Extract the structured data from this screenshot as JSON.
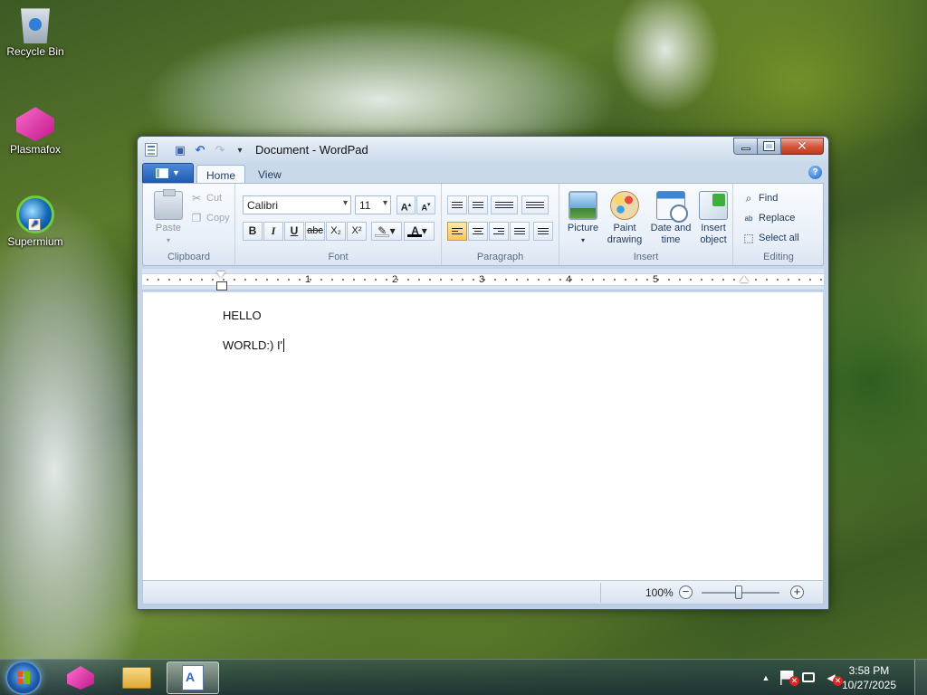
{
  "desktop": {
    "icons": [
      {
        "label": "Recycle Bin"
      },
      {
        "label": "Plasmafox"
      },
      {
        "label": "Supermium"
      }
    ]
  },
  "window": {
    "title": "Document - WordPad",
    "qat_more": "▾",
    "caption": {
      "close": "✕"
    }
  },
  "ribbon": {
    "tabs": {
      "home": "Home",
      "view": "View"
    },
    "help": "?",
    "groups": {
      "clipboard": {
        "label": "Clipboard",
        "paste": "Paste",
        "cut": "Cut",
        "copy": "Copy"
      },
      "font": {
        "label": "Font",
        "font_name": "Calibri",
        "font_size": "11",
        "grow": "A",
        "shrink": "A",
        "bold": "B",
        "italic": "I",
        "underline": "U",
        "strike": "abc",
        "subscript": "X₂",
        "superscript": "X²"
      },
      "paragraph": {
        "label": "Paragraph"
      },
      "insert": {
        "label": "Insert",
        "picture": "Picture",
        "paint": "Paint drawing",
        "datetime": "Date and time",
        "object": "Insert object"
      },
      "editing": {
        "label": "Editing",
        "find": "Find",
        "replace": "Replace",
        "select_all": "Select all"
      }
    }
  },
  "ruler": {
    "numbers": [
      "1",
      "2",
      "3",
      "4",
      "5"
    ]
  },
  "document": {
    "lines": [
      "HELLO",
      "WORLD:) I'"
    ]
  },
  "statusbar": {
    "zoom": "100%",
    "zoom_out": "−",
    "zoom_in": "+"
  },
  "taskbar": {
    "clock_time": "3:58 PM",
    "clock_date": "10/27/2025"
  },
  "colors": {
    "accent": "#1f5db4",
    "active_align": "#f6c95c"
  }
}
